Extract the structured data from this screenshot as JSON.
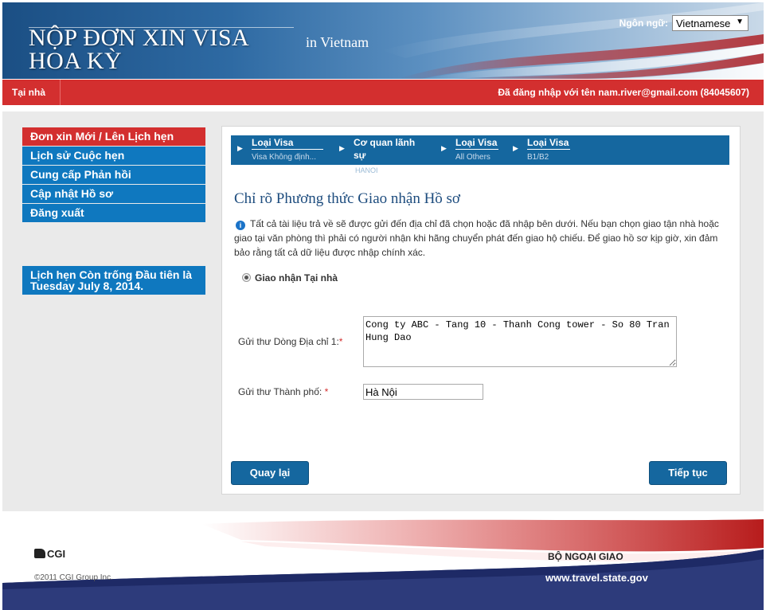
{
  "header": {
    "title_line1": "NỘP ĐƠN XIN VISA",
    "title_line2": "HOA KỲ",
    "country": "in  Vietnam",
    "language_label": "Ngôn ngữ:",
    "language_selected": "Vietnamese"
  },
  "navbar": {
    "home": "Tại nhà",
    "logged_in": "Đã đăng nhập với tên  nam.river@gmail.com (84045607)"
  },
  "sidebar": {
    "items": [
      {
        "label": "Đơn xin Mới / Lên Lịch hẹn"
      },
      {
        "label": "Lịch sử Cuộc hẹn"
      },
      {
        "label": "Cung cấp Phản hồi"
      },
      {
        "label": "Cập nhật Hồ sơ"
      },
      {
        "label": "Đăng xuất"
      }
    ],
    "availability": "Lịch hẹn Còn trống Đầu tiên là Tuesday July 8, 2014."
  },
  "steps": [
    {
      "label": "Loại Visa",
      "sub": "Visa Không định..."
    },
    {
      "label": "Cơ quan lãnh sự",
      "sub": "HANOI"
    },
    {
      "label": "Loại Visa",
      "sub": "All Others"
    },
    {
      "label": "Loại Visa",
      "sub": "B1/B2"
    }
  ],
  "main": {
    "heading": "Chỉ rõ Phương thức Giao nhận Hồ sơ",
    "info_icon": "info-icon",
    "info_text": "Tất cả tài liệu trả về sẽ được gửi đến địa chỉ đã chọn hoặc đã nhập bên dưới. Nếu bạn chọn giao tận nhà hoặc giao tại văn phòng thì phải có người nhận khi hãng chuyển phát đến giao hộ chiếu. Để giao hồ sơ kịp giờ, xin đảm bảo rằng tất cả dữ liệu được nhập chính xác.",
    "delivery_option": "Giao nhận Tại nhà",
    "address_label": "Gửi thư Dòng Địa chỉ 1:",
    "address_value": "Cong ty ABC - Tang 10 - Thanh Cong tower - So 80 Tran Hung Dao",
    "city_label": "Gửi thư Thành phố:",
    "city_value": "Hà Nội",
    "required_mark": "*",
    "back_button": "Quay lại",
    "next_button": "Tiếp tục"
  },
  "footer": {
    "logo": "CGI",
    "copyright": "©2011 CGI Group Inc.",
    "ministry": "BỘ NGOẠI GIAO",
    "website": "www.travel.state.gov"
  },
  "colors": {
    "brand_blue": "#0f78bf",
    "dark_blue": "#15679f",
    "accent_red": "#d32f2f"
  }
}
